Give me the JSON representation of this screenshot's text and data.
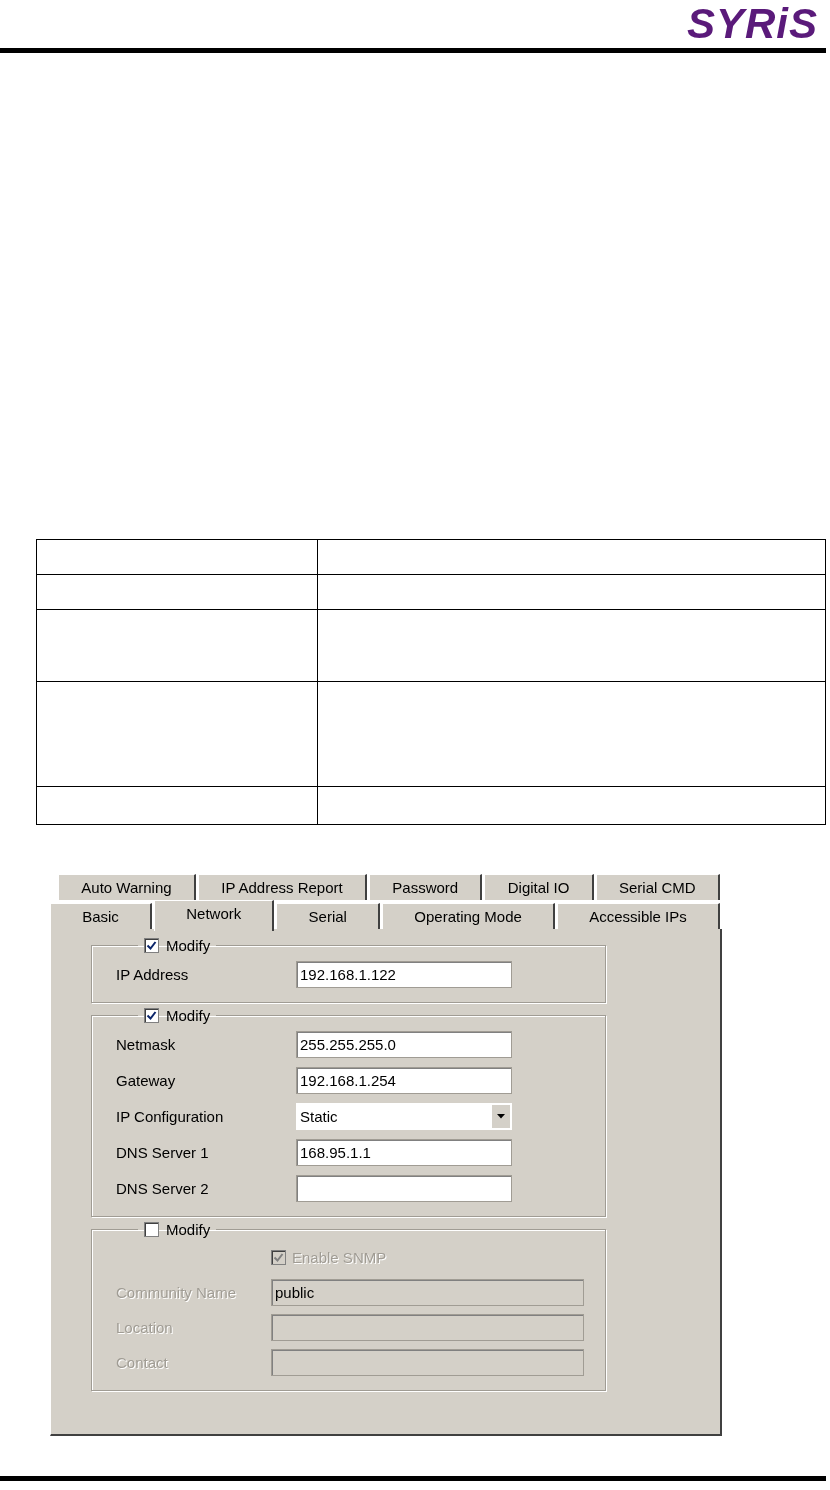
{
  "header": {
    "logo": "SYRiS"
  },
  "dialog": {
    "tab_rows": [
      [
        {
          "label": "Auto Warning",
          "selected": false
        },
        {
          "label": "IP Address Report",
          "selected": false
        },
        {
          "label": "Password",
          "selected": false
        },
        {
          "label": "Digital IO",
          "selected": false
        },
        {
          "label": "Serial CMD",
          "selected": false
        }
      ],
      [
        {
          "label": "Basic",
          "selected": false
        },
        {
          "label": "Network",
          "selected": true
        },
        {
          "label": "Serial",
          "selected": false
        },
        {
          "label": "Operating Mode",
          "selected": false
        },
        {
          "label": "Accessible IPs",
          "selected": false
        }
      ]
    ],
    "groups": [
      {
        "kind": "address",
        "disabled": false,
        "modify": {
          "label": "Modify",
          "checked": true
        },
        "fields": [
          {
            "kind": "text",
            "label": "IP Address",
            "value": "192.168.1.122"
          }
        ]
      },
      {
        "kind": "address",
        "disabled": false,
        "modify": {
          "label": "Modify",
          "checked": true
        },
        "fields": [
          {
            "kind": "text",
            "label": "Netmask",
            "value": "255.255.255.0"
          },
          {
            "kind": "text",
            "label": "Gateway",
            "value": "192.168.1.254"
          },
          {
            "kind": "dropdown",
            "label": "IP Configuration",
            "value": "Static"
          },
          {
            "kind": "text",
            "label": "DNS Server 1",
            "value": "168.95.1.1"
          },
          {
            "kind": "text",
            "label": "DNS Server 2"
          }
        ]
      },
      {
        "kind": "snmp",
        "disabled": true,
        "modify": {
          "label": "Modify",
          "checked": false
        },
        "fields": [
          {
            "kind": "checkbox",
            "label": "Enable SNMP",
            "checked": true
          },
          {
            "kind": "text",
            "label": "Community Name",
            "value": "public"
          },
          {
            "kind": "text",
            "label": "Location"
          },
          {
            "kind": "text",
            "label": "Contact"
          }
        ]
      }
    ]
  }
}
